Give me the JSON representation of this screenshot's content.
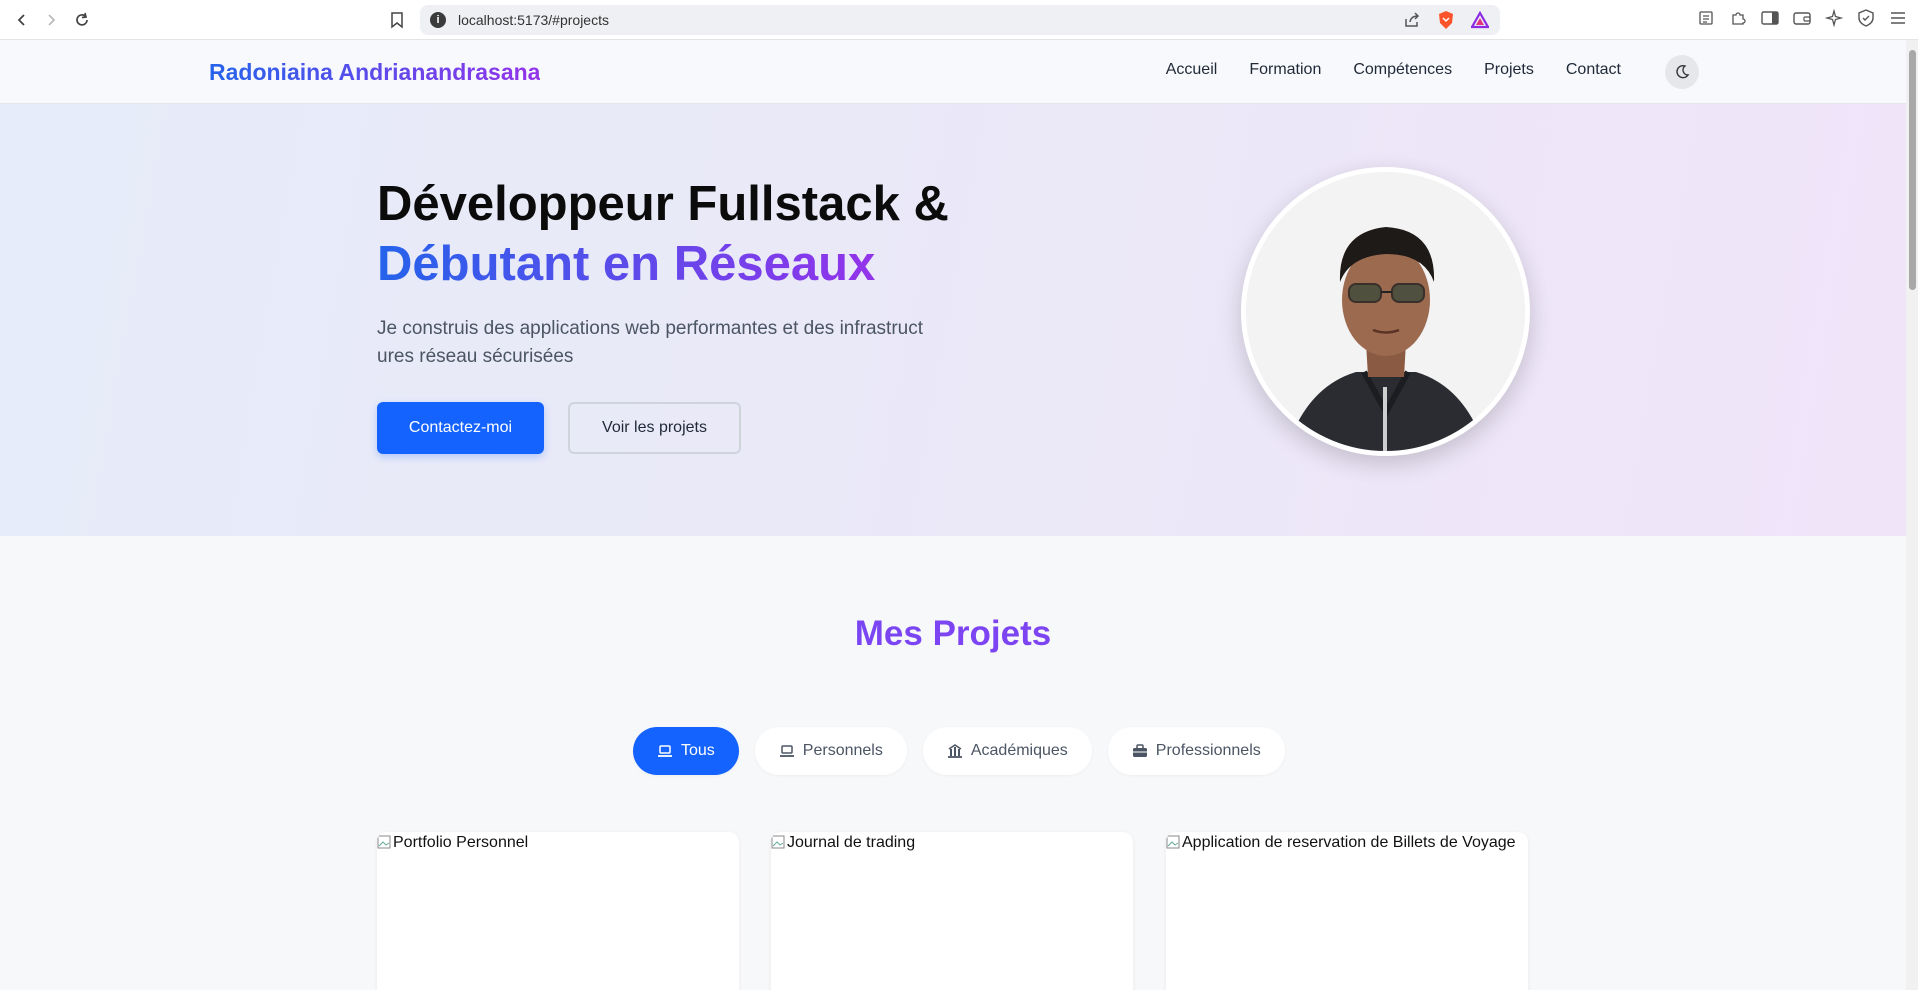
{
  "browser": {
    "url": "localhost:5173/#projects"
  },
  "header": {
    "brand": "Radoniaina Andrianandrasana",
    "nav": [
      "Accueil",
      "Formation",
      "Compétences",
      "Projets",
      "Contact"
    ]
  },
  "hero": {
    "title_line1": "Développeur Fullstack &",
    "title_line2": "Débutant en Réseaux",
    "subtitle_line1": "Je construis des applications web performantes et des infrastruct",
    "subtitle_line2": "ures réseau sécurisées",
    "cta_primary": "Contactez-moi",
    "cta_secondary": "Voir les projets"
  },
  "projects": {
    "title": "Mes Projets",
    "filters": [
      {
        "label": "Tous",
        "icon": "laptop-icon",
        "active": true
      },
      {
        "label": "Personnels",
        "icon": "laptop-icon",
        "active": false
      },
      {
        "label": "Académiques",
        "icon": "university-icon",
        "active": false
      },
      {
        "label": "Professionnels",
        "icon": "briefcase-icon",
        "active": false
      }
    ],
    "cards": [
      {
        "alt": "Portfolio Personnel"
      },
      {
        "alt": "Journal de trading"
      },
      {
        "alt": "Application de reservation de Billets de Voyage"
      }
    ]
  },
  "colors": {
    "primary": "#1463ff",
    "gradient_start": "#2563eb",
    "gradient_end": "#9333ea"
  }
}
